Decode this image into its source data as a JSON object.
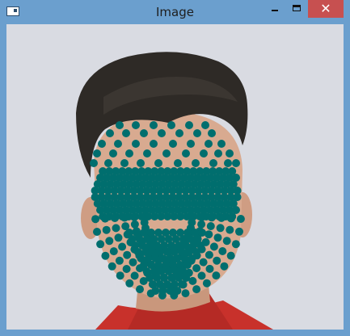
{
  "window": {
    "title": "Image",
    "buttons": {
      "close_glyph": "✕"
    }
  },
  "image": {
    "overlay_color": "#006e6e",
    "background_color": "#d9dbe2",
    "shirt_color": "#c8312b",
    "skin_color": "#d8aa90",
    "hair_color": "#2e2a26"
  }
}
